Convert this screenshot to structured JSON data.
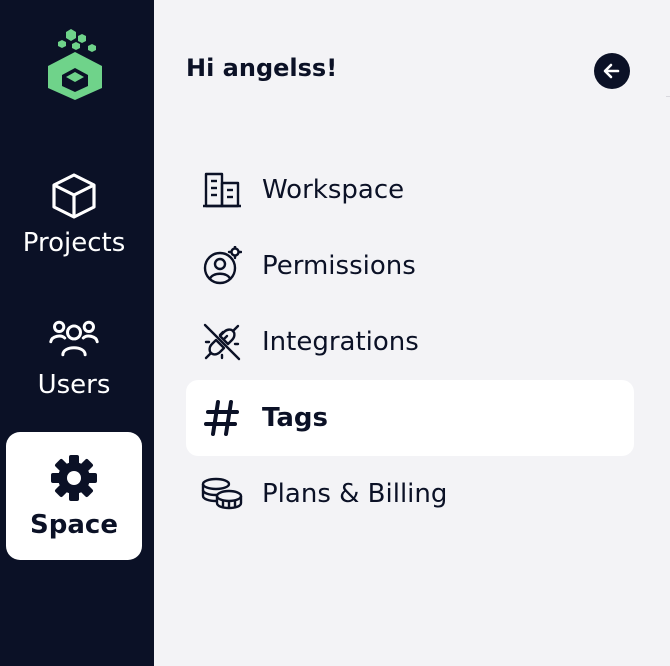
{
  "rail": {
    "items": [
      {
        "label": "Projects",
        "icon": "cube-icon"
      },
      {
        "label": "Users",
        "icon": "users-icon"
      },
      {
        "label": "Space",
        "icon": "gear-icon",
        "active": true
      }
    ]
  },
  "panel": {
    "greeting": "Hi angelss!",
    "menu": [
      {
        "label": "Workspace",
        "icon": "building-icon"
      },
      {
        "label": "Permissions",
        "icon": "user-gear-icon"
      },
      {
        "label": "Integrations",
        "icon": "plug-icon"
      },
      {
        "label": "Tags",
        "icon": "hashtag-icon",
        "active": true
      },
      {
        "label": "Plans & Billing",
        "icon": "coins-icon"
      }
    ]
  },
  "colors": {
    "rail_bg": "#0b1126",
    "panel_bg": "#f3f3f6",
    "logo_green": "#6fd38a",
    "active_bg": "#ffffff"
  }
}
